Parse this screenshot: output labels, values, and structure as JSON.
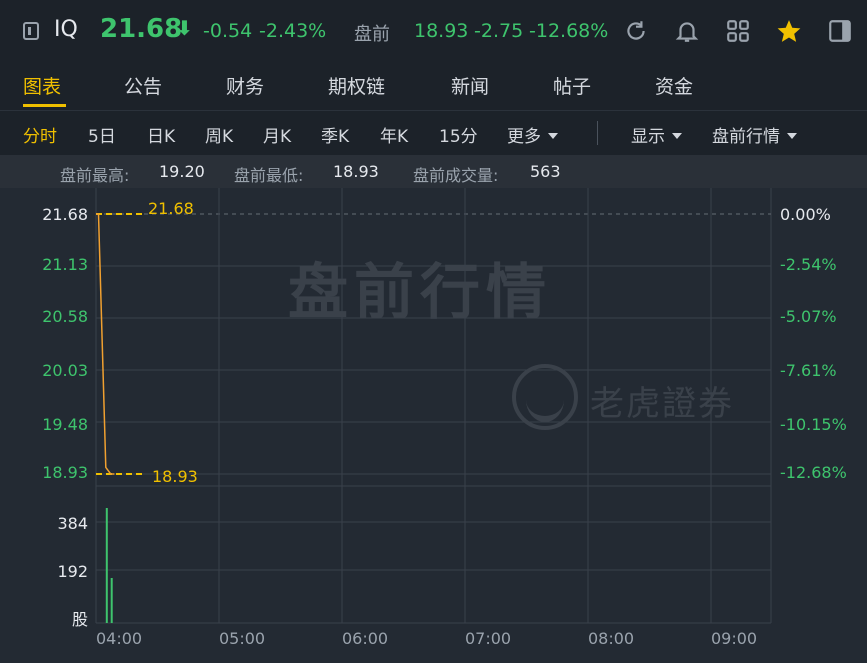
{
  "header": {
    "ticker": "IQ",
    "price": "21.68",
    "arrow": "⬇",
    "change": "-0.54",
    "change_pct": "-2.43%",
    "premarket_label": "盘前",
    "premarket_price": "18.93",
    "premarket_change": "-2.75",
    "premarket_change_pct": "-12.68%",
    "icons": [
      "window-icon",
      "refresh-icon",
      "bell-icon",
      "grid-icon",
      "star-icon",
      "panel-icon"
    ]
  },
  "tabs": [
    "图表",
    "公告",
    "财务",
    "期权链",
    "新闻",
    "帖子",
    "资金"
  ],
  "periods": [
    "分时",
    "5日",
    "日K",
    "周K",
    "月K",
    "季K",
    "年K",
    "15分",
    "更多"
  ],
  "display_label": "显示",
  "premarket_menu": "盘前行情",
  "stats": {
    "high_label": "盘前最高:",
    "high": "19.20",
    "low_label": "盘前最低:",
    "low": "18.93",
    "vol_label": "盘前成交量:",
    "vol": "563"
  },
  "chart_data": {
    "type": "line",
    "y_ticks": [
      "21.68",
      "21.13",
      "20.58",
      "20.03",
      "19.48",
      "18.93"
    ],
    "pct_ticks": [
      "0.00%",
      "-2.54%",
      "-5.07%",
      "-7.61%",
      "-10.15%",
      "-12.68%"
    ],
    "vol_ticks": [
      "384",
      "192",
      "股"
    ],
    "x_ticks": [
      "04:00",
      "05:00",
      "06:00",
      "07:00",
      "08:00",
      "09:00"
    ],
    "price_line": [
      [
        0,
        21.68
      ],
      [
        0.02,
        21.68
      ],
      [
        0.08,
        19.0
      ],
      [
        0.12,
        18.93
      ],
      [
        0.15,
        18.93
      ]
    ],
    "ylim": [
      18.93,
      21.68
    ],
    "ref_high": "21.68",
    "ref_low": "18.93",
    "volume": [
      {
        "t": 0.08,
        "v": 460
      },
      {
        "t": 0.12,
        "v": 180
      }
    ],
    "vol_max": 500,
    "watermark": "盘前行情",
    "brand": "老虎證券"
  }
}
